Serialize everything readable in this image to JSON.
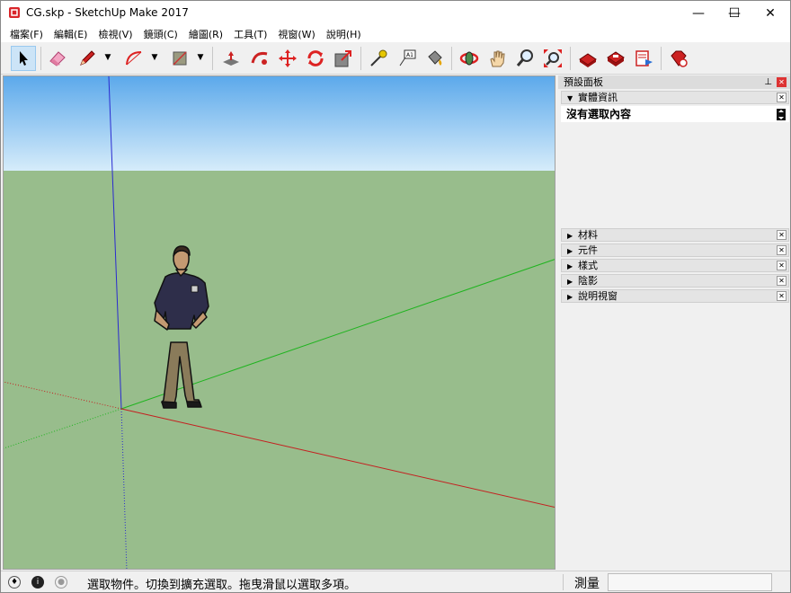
{
  "window": {
    "title": "CG.skp - SketchUp Make 2017",
    "minimize": "—",
    "maximize": "☐",
    "close": "✕"
  },
  "menu": [
    "檔案(F)",
    "編輯(E)",
    "檢視(V)",
    "鏡頭(C)",
    "繪圖(R)",
    "工具(T)",
    "視窗(W)",
    "說明(H)"
  ],
  "toolbar": {
    "icons": [
      "select-icon",
      "eraser-icon",
      "pencil-icon",
      "arc-icon",
      "rectangle-icon",
      "push-pull-icon",
      "follow-me-icon",
      "move-icon",
      "rotate-icon",
      "scale-icon",
      "tape-measure-icon",
      "text-icon",
      "paint-bucket-icon",
      "orbit-icon",
      "pan-icon",
      "zoom-icon",
      "zoom-extents-icon",
      "warehouse-icon",
      "extension-warehouse-icon",
      "layout-icon",
      "extension-manager-icon"
    ]
  },
  "viewport": {
    "sky_color": "#a8d4f5",
    "ground_color": "#98bd8c"
  },
  "panel": {
    "title": "預設面板",
    "entity_info": {
      "header": "實體資訊",
      "content": "沒有選取內容"
    },
    "collapsed": [
      "材料",
      "元件",
      "樣式",
      "陰影",
      "說明視窗"
    ]
  },
  "status": {
    "text": "選取物件。切換到擴充選取。拖曳滑鼠以選取多項。",
    "measure_label": "測量",
    "measure_value": ""
  }
}
